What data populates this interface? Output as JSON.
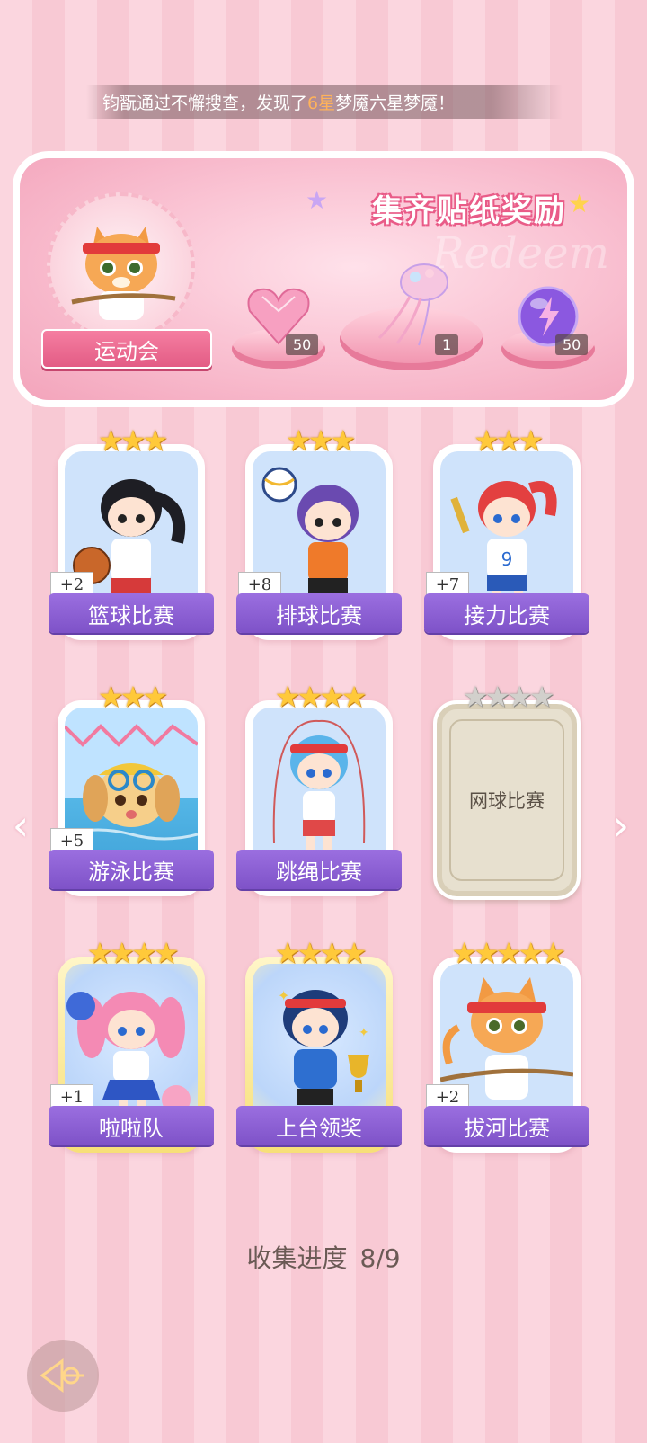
{
  "marquee": {
    "prefix": "钧翫通过不懈搜查，发现了",
    "highlight": "6星",
    "suffix": "梦魇六星梦魇！"
  },
  "reward_panel": {
    "title": "集齐贴纸奖励",
    "watermark": "Redeem",
    "event_name": "运动会",
    "items": [
      {
        "icon": "pink-heart-gem-icon",
        "count": "50"
      },
      {
        "icon": "jellyfish-decoration-icon",
        "count": "1"
      },
      {
        "icon": "purple-lightning-orb-icon",
        "count": "50"
      }
    ]
  },
  "cards": [
    {
      "name": "篮球比赛",
      "stars": 3,
      "bonus": "+2",
      "collected": true,
      "gold": false,
      "art": "basketball-girl-art"
    },
    {
      "name": "排球比赛",
      "stars": 3,
      "bonus": "+8",
      "collected": true,
      "gold": false,
      "art": "volleyball-girl-art"
    },
    {
      "name": "接力比赛",
      "stars": 3,
      "bonus": "+7",
      "collected": true,
      "gold": false,
      "art": "relay-girl-art"
    },
    {
      "name": "游泳比赛",
      "stars": 3,
      "bonus": "+5",
      "collected": true,
      "gold": false,
      "art": "swimming-dog-art"
    },
    {
      "name": "跳绳比赛",
      "stars": 4,
      "bonus": "",
      "collected": true,
      "gold": false,
      "art": "jump-rope-girl-art"
    },
    {
      "name": "网球比赛",
      "stars": 4,
      "bonus": "",
      "collected": false,
      "gold": false,
      "art": "locked-card"
    },
    {
      "name": "啦啦队",
      "stars": 4,
      "bonus": "+1",
      "collected": true,
      "gold": true,
      "art": "cheerleader-girl-art"
    },
    {
      "name": "上台领奖",
      "stars": 4,
      "bonus": "",
      "collected": true,
      "gold": true,
      "art": "award-girl-art"
    },
    {
      "name": "拔河比赛",
      "stars": 5,
      "bonus": "+2",
      "collected": true,
      "gold": false,
      "art": "tug-of-war-cat-art"
    }
  ],
  "progress": {
    "label": "收集进度",
    "value": "8/9"
  },
  "colors": {
    "accent_pink": "#e35c85",
    "card_label_purple": "#8a5fd4",
    "star_gold": "#ffc93a"
  }
}
